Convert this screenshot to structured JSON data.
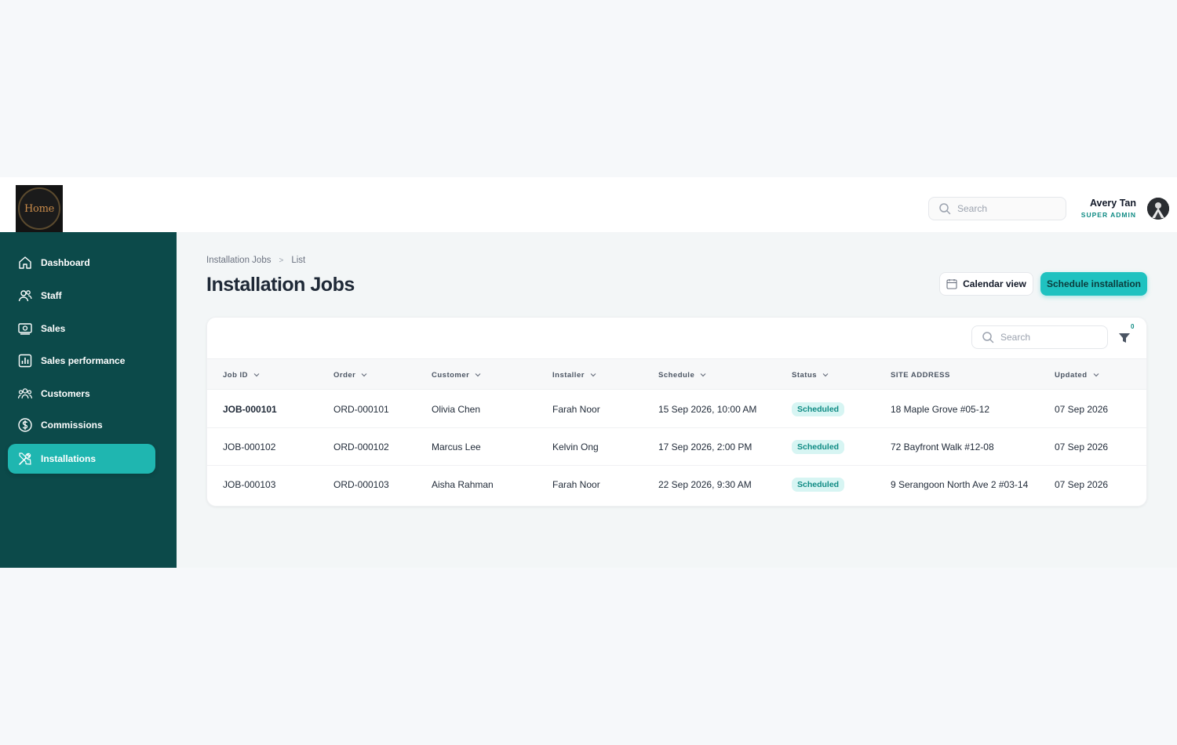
{
  "header": {
    "logo_text": "Home",
    "search_placeholder": "Search",
    "user_name": "Avery Tan",
    "user_role": "SUPER ADMIN"
  },
  "sidebar": {
    "items": [
      {
        "label": "Dashboard",
        "icon": "home-icon",
        "active": false
      },
      {
        "label": "Staff",
        "icon": "users-icon",
        "active": false
      },
      {
        "label": "Sales",
        "icon": "cash-icon",
        "active": false
      },
      {
        "label": "Sales performance",
        "icon": "bar-chart-icon",
        "active": false
      },
      {
        "label": "Customers",
        "icon": "customers-icon",
        "active": false
      },
      {
        "label": "Commissions",
        "icon": "dollar-icon",
        "active": false
      },
      {
        "label": "Installations",
        "icon": "tools-icon",
        "active": true
      }
    ]
  },
  "breadcrumb": {
    "parent": "Installation Jobs",
    "current": "List"
  },
  "page": {
    "title": "Installation Jobs",
    "calendar_label": "Calendar view",
    "schedule_label": "Schedule installation"
  },
  "table": {
    "search_placeholder": "Search",
    "filter_count": "0",
    "columns": [
      "Job ID",
      "Order",
      "Customer",
      "Installer",
      "Schedule",
      "Status",
      "SITE ADDRESS",
      "Updated"
    ],
    "rows": [
      [
        "JOB-000101",
        "ORD-000101",
        "Olivia Chen",
        "Farah Noor",
        "15 Sep 2026, 10:00 AM",
        "Scheduled",
        "18 Maple Grove #05-12",
        "07 Sep 2026"
      ],
      [
        "JOB-000102",
        "ORD-000102",
        "Marcus Lee",
        "Kelvin Ong",
        "17 Sep 2026, 2:00 PM",
        "Scheduled",
        "72 Bayfront Walk #12-08",
        "07 Sep 2026"
      ],
      [
        "JOB-000103",
        "ORD-000103",
        "Aisha Rahman",
        "Farah Noor",
        "22 Sep 2026, 9:30 AM",
        "Scheduled",
        "9 Serangoon North Ave 2 #03-14",
        "07 Sep 2026"
      ]
    ]
  },
  "colors": {
    "sidebar_bg": "#0c4a4a",
    "accent": "#1fc2c0",
    "badge_bg": "#d7f5f3",
    "badge_text": "#0f8b84"
  }
}
